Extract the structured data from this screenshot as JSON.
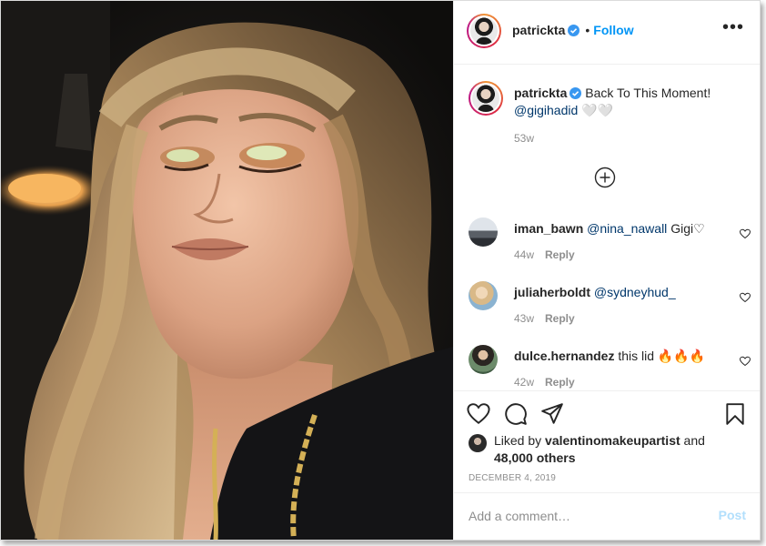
{
  "post": {
    "author": "patrickta",
    "follow_label": "Follow",
    "separator": "•",
    "more_label": "•••",
    "verified": true
  },
  "caption": {
    "author": "patrickta",
    "text": "Back To This Moment!",
    "mention": "@gigihadid",
    "emoji": "🤍🤍",
    "time": "53w"
  },
  "comments": [
    {
      "user": "iman_bawn",
      "mention": "@nina_nawall",
      "text": "Gigi♡",
      "time": "44w",
      "reply_label": "Reply"
    },
    {
      "user": "juliaherboldt",
      "mention": "@sydneyhud_",
      "text": "",
      "time": "43w",
      "reply_label": "Reply"
    },
    {
      "user": "dulce.hernandez",
      "mention": "",
      "text": "this lid 🔥🔥🔥",
      "time": "42w",
      "reply_label": "Reply"
    }
  ],
  "likes": {
    "prefix": "Liked by",
    "user": "valentinomakeupartist",
    "suffix": "and",
    "others": "48,000 others"
  },
  "date": "DECEMBER 4, 2019",
  "add_comment": {
    "placeholder": "Add a comment…",
    "post_label": "Post"
  },
  "colors": {
    "accent": "#0095f6",
    "post_disabled": "#b2dffc",
    "muted": "#8e8e8e",
    "mention": "#00376b"
  },
  "icons": {
    "like": "heart-icon",
    "comment": "comment-icon",
    "share": "share-icon",
    "save": "bookmark-icon",
    "load_more": "plus-circle-icon",
    "verified": "verified-badge-icon"
  }
}
